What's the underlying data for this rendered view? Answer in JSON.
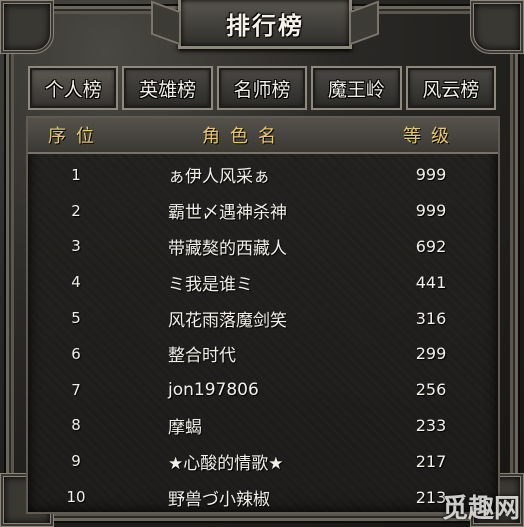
{
  "window": {
    "title": "排行榜"
  },
  "tabs": [
    {
      "label": "个人榜",
      "active": true
    },
    {
      "label": "英雄榜",
      "active": false
    },
    {
      "label": "名师榜",
      "active": false
    },
    {
      "label": "魔王岭",
      "active": false
    },
    {
      "label": "风云榜",
      "active": false
    }
  ],
  "table": {
    "headers": {
      "rank": "序位",
      "name": "角色名",
      "level": "等级"
    },
    "rows": [
      {
        "rank": "1",
        "name": "ぁ伊人风采ぁ",
        "level": "999"
      },
      {
        "rank": "2",
        "name": "霸世〆遇神杀神",
        "level": "999"
      },
      {
        "rank": "3",
        "name": "带藏獒的西藏人",
        "level": "692"
      },
      {
        "rank": "4",
        "name": "ミ我是谁ミ",
        "level": "441"
      },
      {
        "rank": "5",
        "name": "风花雨落魔剑笑",
        "level": "316"
      },
      {
        "rank": "6",
        "name": "整合时代",
        "level": "299"
      },
      {
        "rank": "7",
        "name": "jon197806",
        "level": "256"
      },
      {
        "rank": "8",
        "name": "摩蝎",
        "level": "233"
      },
      {
        "rank": "9",
        "name": "★心酸的情歌★",
        "level": "217"
      },
      {
        "rank": "10",
        "name": "野兽づ小辣椒",
        "level": "213"
      }
    ]
  },
  "watermark": {
    "text": "觅趣网"
  },
  "colors": {
    "header_text": "#e8c66a",
    "row_text": "#f1efe8",
    "frame": "#8d877c"
  }
}
